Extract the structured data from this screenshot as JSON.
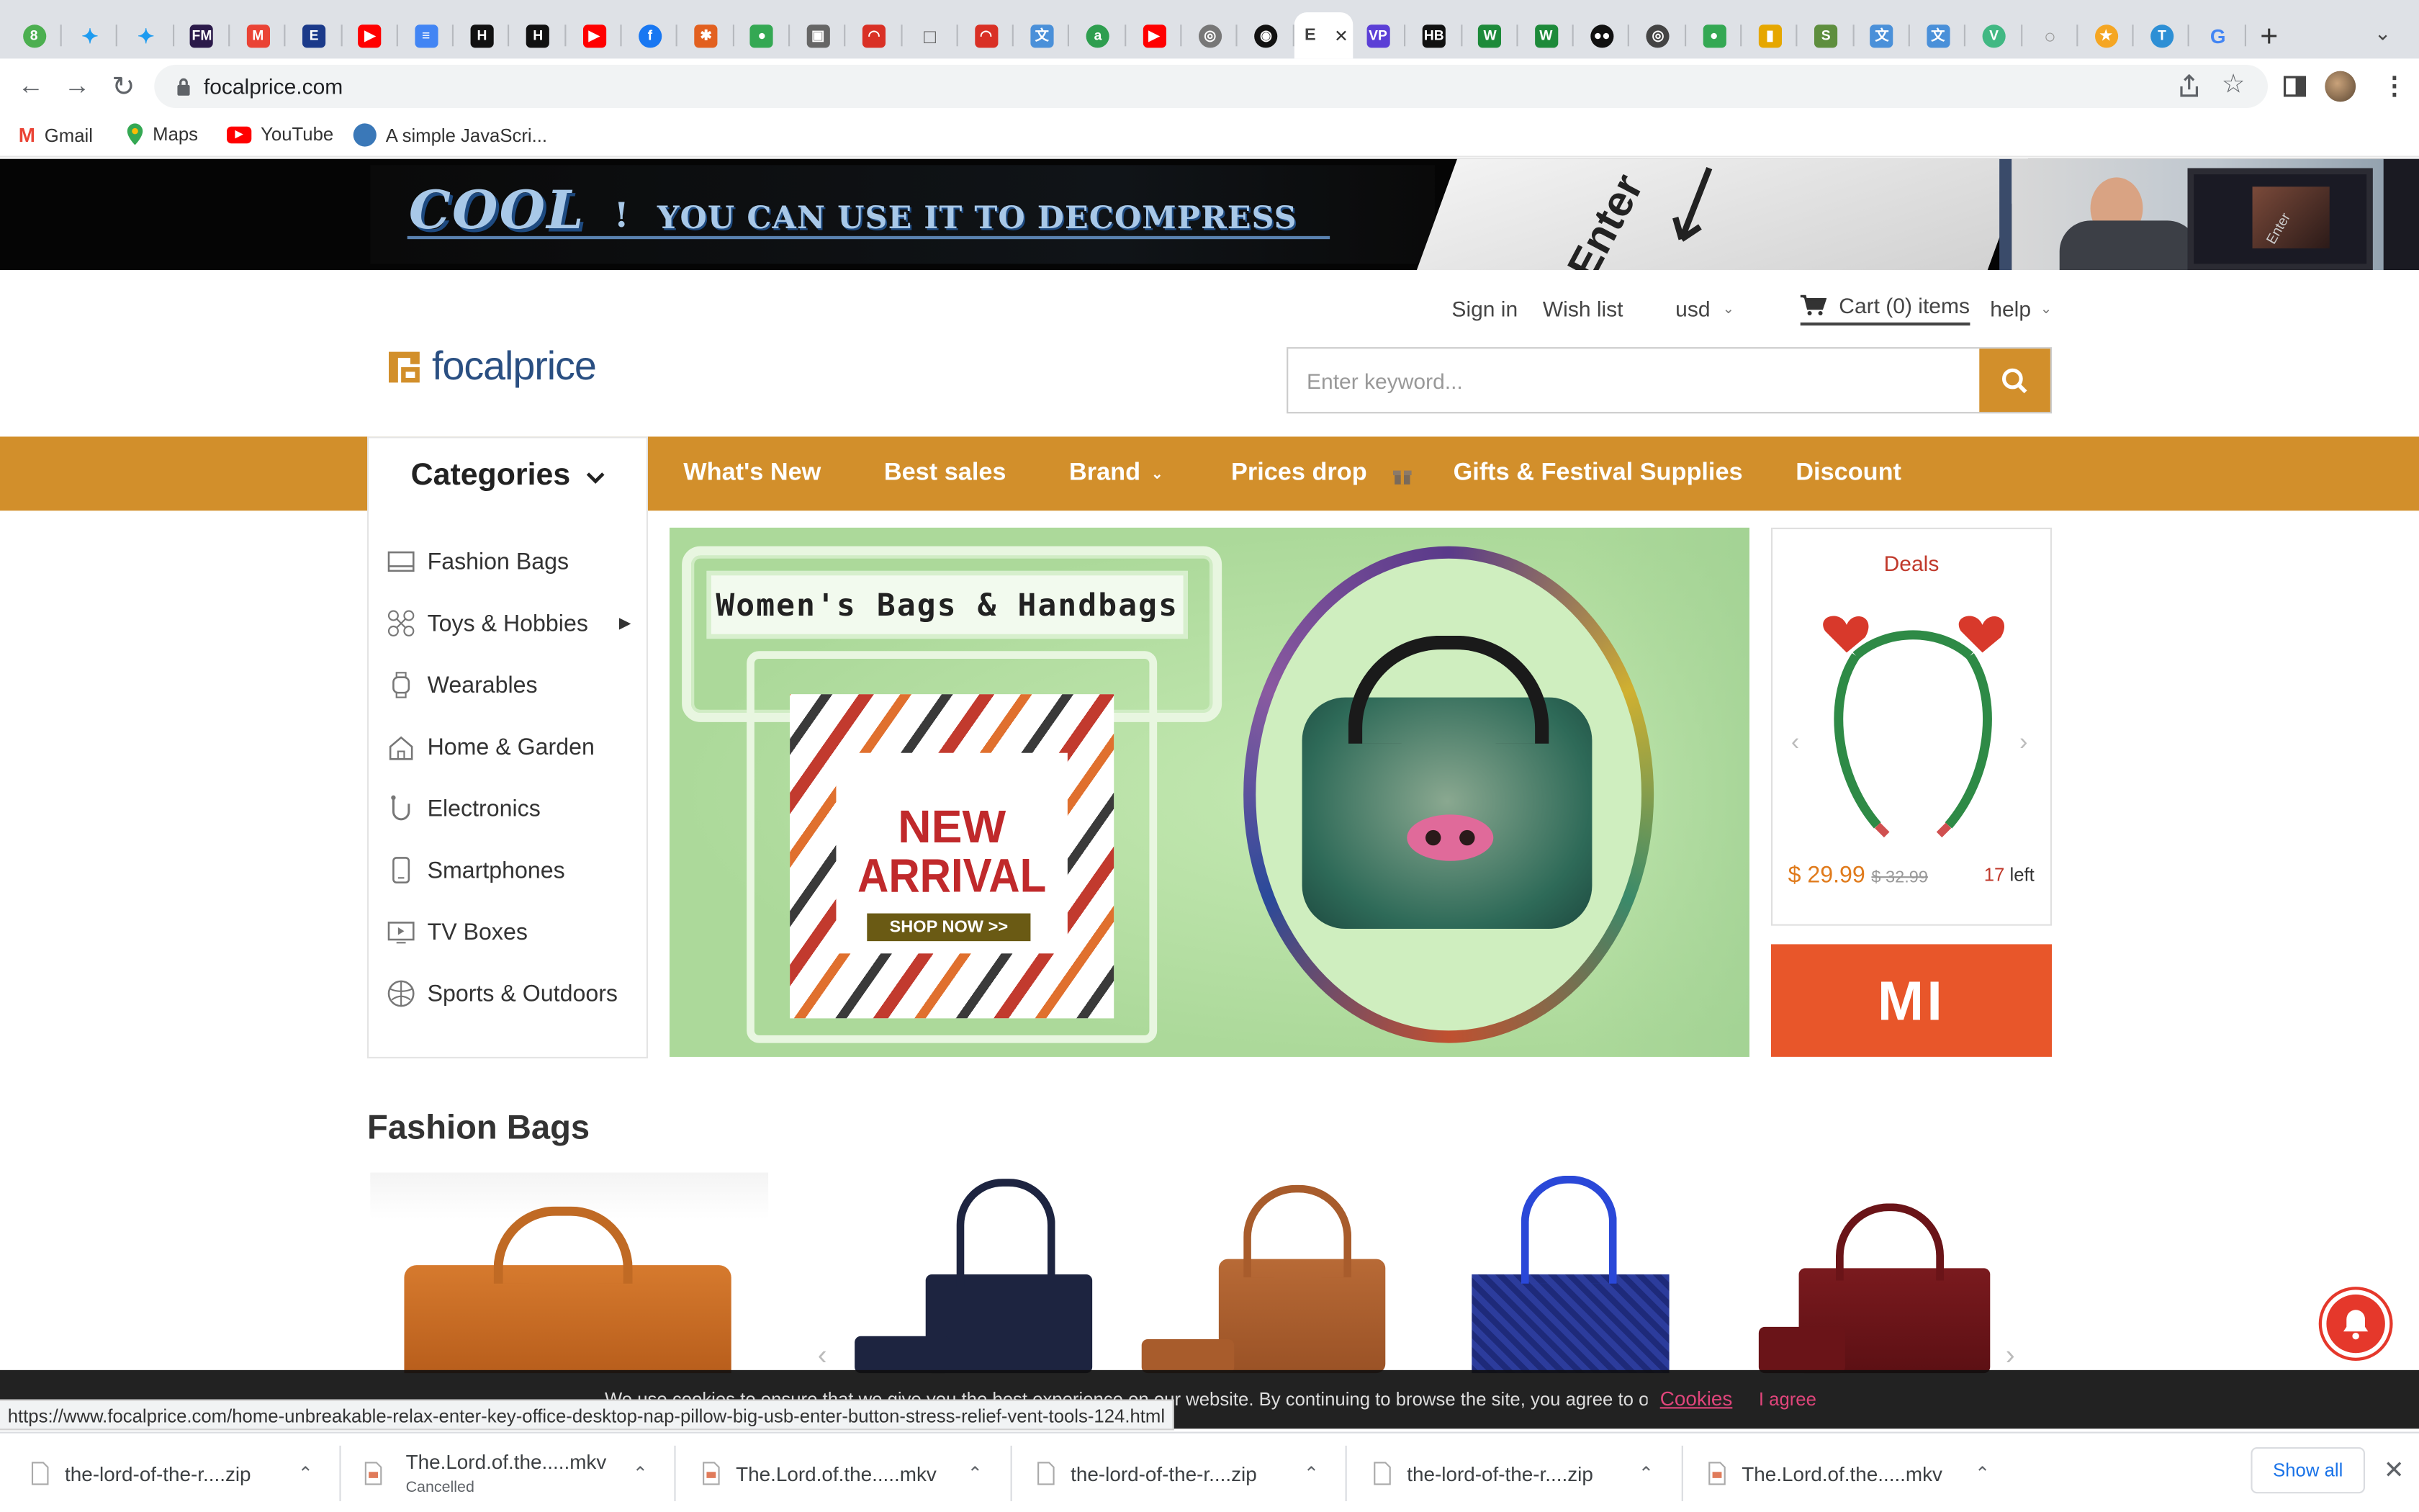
{
  "browser": {
    "tabs": [
      {
        "icon": "green-circle-icon",
        "color": "#4caf50",
        "glyph": "8"
      },
      {
        "icon": "twitter-icon",
        "color": "#1d9bf0",
        "glyph": "✦"
      },
      {
        "icon": "twitter-icon",
        "color": "#1d9bf0",
        "glyph": "✦"
      },
      {
        "icon": "fm-icon",
        "color": "#2b1a4a",
        "glyph": "FM"
      },
      {
        "icon": "gmail-icon",
        "color": "#ea4335",
        "glyph": "M"
      },
      {
        "icon": "exchange-icon",
        "color": "#1b3a8a",
        "glyph": "E"
      },
      {
        "icon": "youtube-icon",
        "color": "#ff0000",
        "glyph": "▶"
      },
      {
        "icon": "docs-icon",
        "color": "#4285f4",
        "glyph": "≡"
      },
      {
        "icon": "hn-icon",
        "color": "#111111",
        "glyph": "H"
      },
      {
        "icon": "hn-icon",
        "color": "#111111",
        "glyph": "H"
      },
      {
        "icon": "youtube-icon",
        "color": "#ff0000",
        "glyph": "▶"
      },
      {
        "icon": "facebook-icon",
        "color": "#1877f2",
        "glyph": "f"
      },
      {
        "icon": "shield-icon",
        "color": "#e2601f",
        "glyph": "✱"
      },
      {
        "icon": "maps-icon",
        "color": "#34a853",
        "glyph": "●"
      },
      {
        "icon": "image-icon",
        "color": "#666666",
        "glyph": "▣"
      },
      {
        "icon": "speed-icon",
        "color": "#d93025",
        "glyph": "◠"
      },
      {
        "icon": "square-icon",
        "color": "#555555",
        "glyph": "□"
      },
      {
        "icon": "speed-icon",
        "color": "#d93025",
        "glyph": "◠"
      },
      {
        "icon": "translate-icon",
        "color": "#4a90d9",
        "glyph": "文"
      },
      {
        "icon": "green-app-icon",
        "color": "#2e9e4f",
        "glyph": "a"
      },
      {
        "icon": "youtube-icon",
        "color": "#ff0000",
        "glyph": "▶"
      },
      {
        "icon": "globe-icon",
        "color": "#777777",
        "glyph": "◎"
      },
      {
        "icon": "github-icon",
        "color": "#111111",
        "glyph": "◉"
      },
      {
        "icon": "active-tab-icon",
        "color": "#444444",
        "glyph": "E",
        "active": true
      },
      {
        "icon": "vp-icon",
        "color": "#5b3fd6",
        "glyph": "VP"
      },
      {
        "icon": "hb-icon",
        "color": "#111111",
        "glyph": "HB"
      },
      {
        "icon": "w-icon",
        "color": "#1d8a3a",
        "glyph": "W"
      },
      {
        "icon": "w-icon",
        "color": "#1d8a3a",
        "glyph": "W"
      },
      {
        "icon": "medium-icon",
        "color": "#111111",
        "glyph": "●●"
      },
      {
        "icon": "globe-icon",
        "color": "#444444",
        "glyph": "◎"
      },
      {
        "icon": "maps-icon",
        "color": "#34a853",
        "glyph": "●"
      },
      {
        "icon": "bag-icon",
        "color": "#e6a700",
        "glyph": "▮"
      },
      {
        "icon": "shopify-icon",
        "color": "#5e8e3e",
        "glyph": "S"
      },
      {
        "icon": "translate-icon",
        "color": "#4a90d9",
        "glyph": "文"
      },
      {
        "icon": "translate-icon",
        "color": "#4a90d9",
        "glyph": "文"
      },
      {
        "icon": "vue-icon",
        "color": "#41b883",
        "glyph": "V"
      },
      {
        "icon": "circle-icon",
        "color": "#999999",
        "glyph": "○"
      },
      {
        "icon": "star-icon",
        "color": "#f5a623",
        "glyph": "★"
      },
      {
        "icon": "t-icon",
        "color": "#2d8fd5",
        "glyph": "T"
      },
      {
        "icon": "google-icon",
        "color": "#4285f4",
        "glyph": "G"
      }
    ],
    "active_tab_label": "E",
    "url": "focalprice.com",
    "bookmarks": [
      {
        "label": "Gmail",
        "icon": "gmail-icon"
      },
      {
        "label": "Maps",
        "icon": "maps-icon"
      },
      {
        "label": "YouTube",
        "icon": "youtube-icon"
      },
      {
        "label": "A simple JavaScri...",
        "icon": "puzzle-icon"
      }
    ]
  },
  "banner": {
    "headline_cool": "COOL",
    "headline_bang": "!",
    "headline_rest": "YOU CAN USE IT TO DECOMPRESS",
    "key_label": "Enter",
    "screen_label": "Enter"
  },
  "header": {
    "sign_in": "Sign in",
    "wish_list": "Wish list",
    "currency": "usd",
    "cart": "Cart (0) items",
    "help": "help",
    "logo_text": "focalprice",
    "search_placeholder": "Enter keyword..."
  },
  "nav": {
    "categories_label": "Categories",
    "items": [
      "What's New",
      "Best sales",
      "Brand",
      "Prices drop",
      "Gifts & Festival Supplies",
      "Discount"
    ]
  },
  "categories": [
    {
      "label": "Fashion Bags",
      "icon": "bag-icon"
    },
    {
      "label": "Toys & Hobbies",
      "icon": "drone-icon",
      "has_submenu": true
    },
    {
      "label": "Wearables",
      "icon": "watch-icon"
    },
    {
      "label": "Home & Garden",
      "icon": "home-icon"
    },
    {
      "label": "Electronics",
      "icon": "headphone-icon"
    },
    {
      "label": "Smartphones",
      "icon": "phone-icon"
    },
    {
      "label": "TV Boxes",
      "icon": "tv-icon"
    },
    {
      "label": "Sports & Outdoors",
      "icon": "ball-icon"
    }
  ],
  "hero": {
    "title": "Women's Bags & Handbags",
    "new_label": "NEW",
    "arrival_label": "ARRIVAL",
    "shop_now": "SHOP NOW >>"
  },
  "deals": {
    "title": "Deals",
    "price": "$ 29.99",
    "old_price": "$ 32.99",
    "left_count": "17",
    "left_label": "left"
  },
  "mi_logo": "MI",
  "fashion_bags": {
    "title": "Fashion Bags"
  },
  "cookie": {
    "text": "We use cookies to ensure that we give you the best experience on our website. By continuing to browse the site, you agree to our use of",
    "link": "Cookies",
    "agree": "I agree"
  },
  "status_url": "https://www.focalprice.com/home-unbreakable-relax-enter-key-office-desktop-nap-pillow-big-usb-enter-button-stress-relief-vent-tools-124.html",
  "downloads": {
    "items": [
      {
        "name": "the-lord-of-the-r....zip",
        "status": ""
      },
      {
        "name": "The.Lord.of.the.....mkv",
        "status": "Cancelled"
      },
      {
        "name": "The.Lord.of.the.....mkv",
        "status": ""
      },
      {
        "name": "the-lord-of-the-r....zip",
        "status": ""
      },
      {
        "name": "the-lord-of-the-r....zip",
        "status": ""
      },
      {
        "name": "The.Lord.of.the.....mkv",
        "status": ""
      }
    ],
    "show_all": "Show all"
  },
  "colors": {
    "brand_orange": "#d28f2b",
    "price_orange": "#e07b1c",
    "deals_red": "#c0392b",
    "mi_orange": "#e8562a",
    "cookie_link": "#e0457b"
  }
}
